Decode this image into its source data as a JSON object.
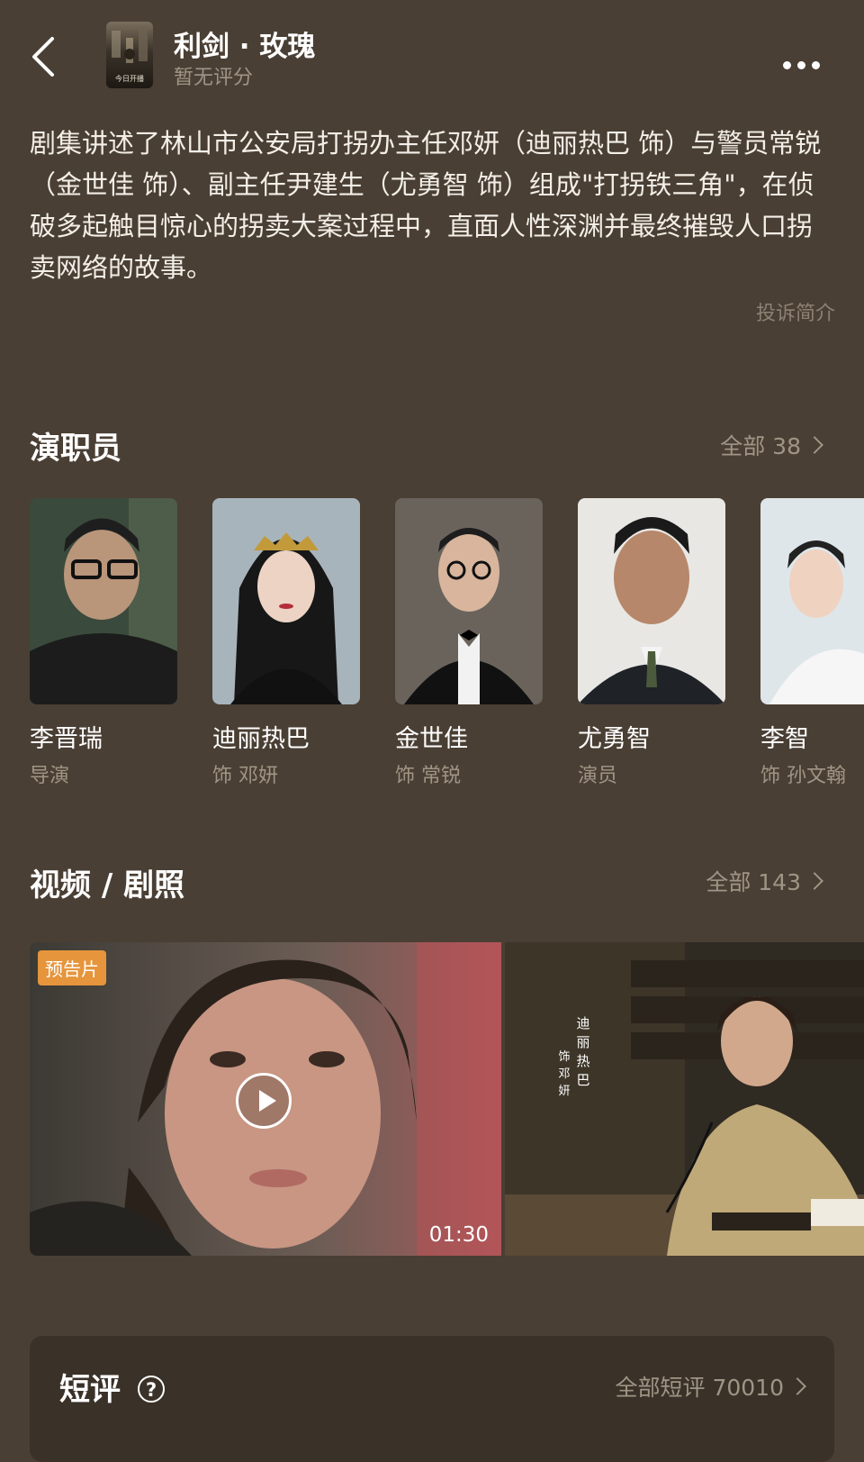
{
  "header": {
    "title": "利剑 · 玫瑰",
    "rating": "暂无评分",
    "poster_caption": "今日开播"
  },
  "description": {
    "text": "剧集讲述了林山市公安局打拐办主任邓妍（迪丽热巴 饰）与警员常锐（金世佳 饰）、副主任尹建生（尤勇智 饰）组成\"打拐铁三角\"，在侦破多起触目惊心的拐卖大案过程中，直面人性深渊并最终摧毁人口拐卖网络的故事。",
    "complain_label": "投诉简介"
  },
  "cast_section": {
    "title": "演职员",
    "all_label": "全部 38",
    "items": [
      {
        "name": "李晋瑞",
        "role": "导演"
      },
      {
        "name": "迪丽热巴",
        "role": "饰 邓妍"
      },
      {
        "name": "金世佳",
        "role": "饰 常锐"
      },
      {
        "name": "尤勇智",
        "role": "演员"
      },
      {
        "name": "李智",
        "role": "饰 孙文翰"
      }
    ]
  },
  "media_section": {
    "title": "视频 / 剧照",
    "all_label": "全部 143",
    "items": [
      {
        "tag": "预告片",
        "duration": "01:30"
      },
      {
        "overlay_text": "迪丽热巴",
        "overlay_sub": "饰邓妍"
      }
    ]
  },
  "reviews": {
    "title": "短评",
    "help_icon": "?",
    "all_label": "全部短评 70010"
  },
  "colors": {
    "background": "#4a3f34",
    "card": "#3a3128",
    "muted_text": "#a09585",
    "tag_orange": "#e6953c"
  }
}
